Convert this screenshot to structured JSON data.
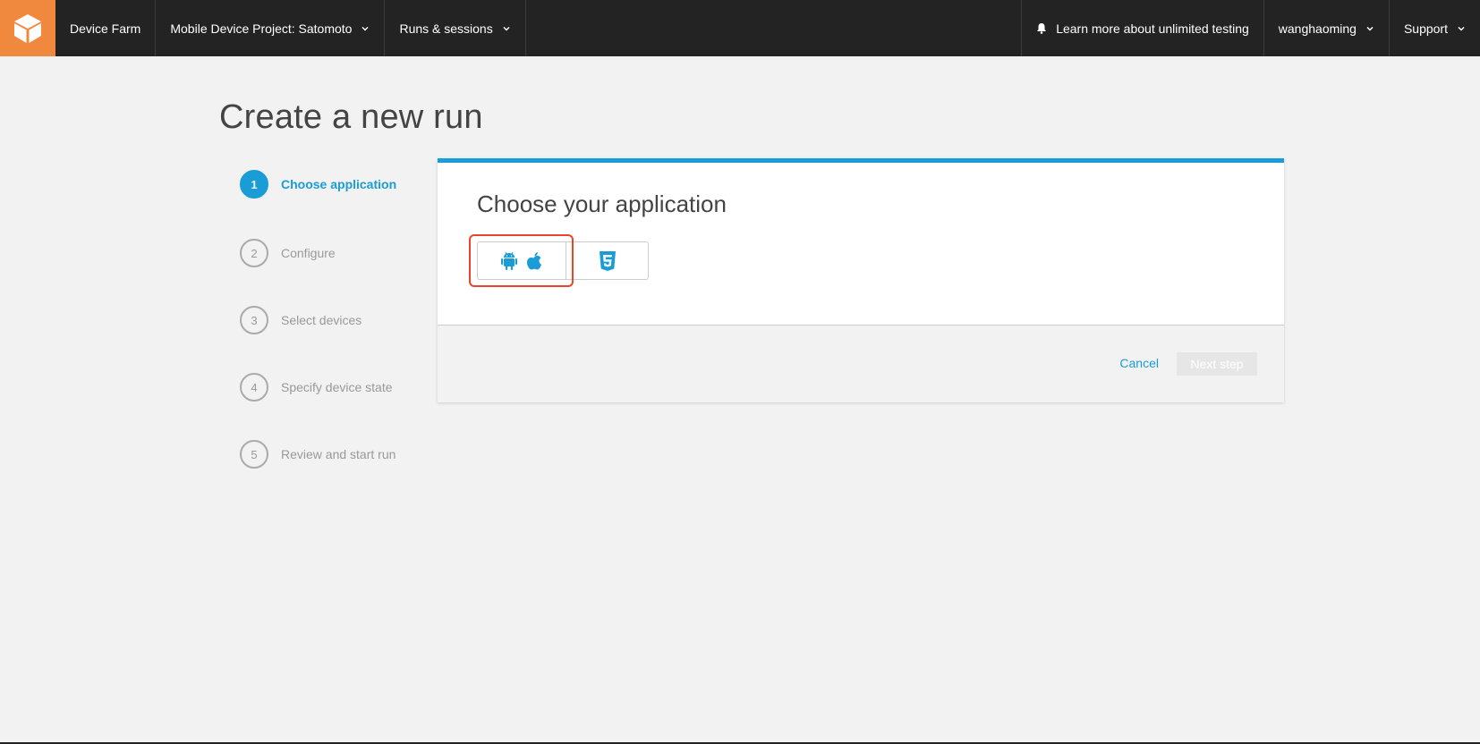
{
  "nav": {
    "service": "Device Farm",
    "project": "Mobile Device Project: Satomoto",
    "runs": "Runs & sessions",
    "learn_more": "Learn more about unlimited testing",
    "user": "wanghaoming",
    "support": "Support"
  },
  "page": {
    "title": "Create a new run"
  },
  "steps": [
    {
      "num": "1",
      "label": "Choose application"
    },
    {
      "num": "2",
      "label": "Configure"
    },
    {
      "num": "3",
      "label": "Select devices"
    },
    {
      "num": "4",
      "label": "Specify device state"
    },
    {
      "num": "5",
      "label": "Review and start run"
    }
  ],
  "panel": {
    "title": "Choose your application",
    "cancel_label": "Cancel",
    "next_label": "Next step"
  },
  "colors": {
    "accent": "#1a9cd6",
    "logo": "#f0883e",
    "nav_bg": "#232323",
    "highlight": "#e8452c"
  },
  "icons": [
    "cube-logo-icon",
    "chevron-down-icon",
    "bell-icon",
    "android-icon",
    "apple-icon",
    "html5-icon"
  ]
}
